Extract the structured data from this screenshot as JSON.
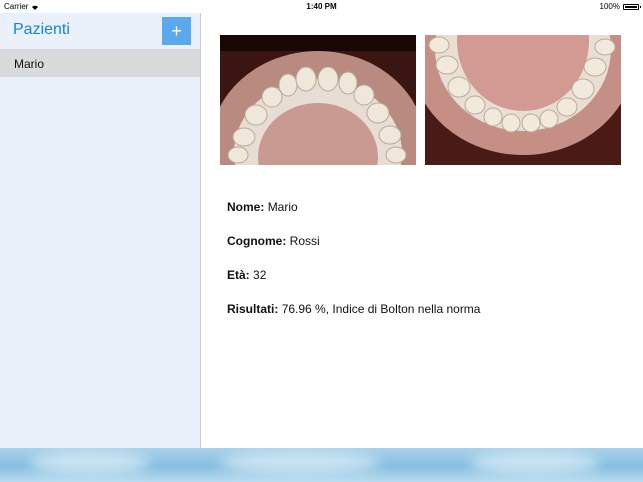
{
  "status_bar": {
    "carrier": "Carrier",
    "time": "1:40 PM",
    "battery": "100%"
  },
  "sidebar": {
    "title": "Pazienti",
    "add_label": "+",
    "patients": [
      "Mario"
    ]
  },
  "patient": {
    "name_label": "Nome:",
    "name": "Mario",
    "surname_label": "Cognome:",
    "surname": "Rossi",
    "age_label": "Età:",
    "age": "32",
    "results_label": "Risultati:",
    "results": "76.96 %, Indice di Bolton nella norma"
  }
}
